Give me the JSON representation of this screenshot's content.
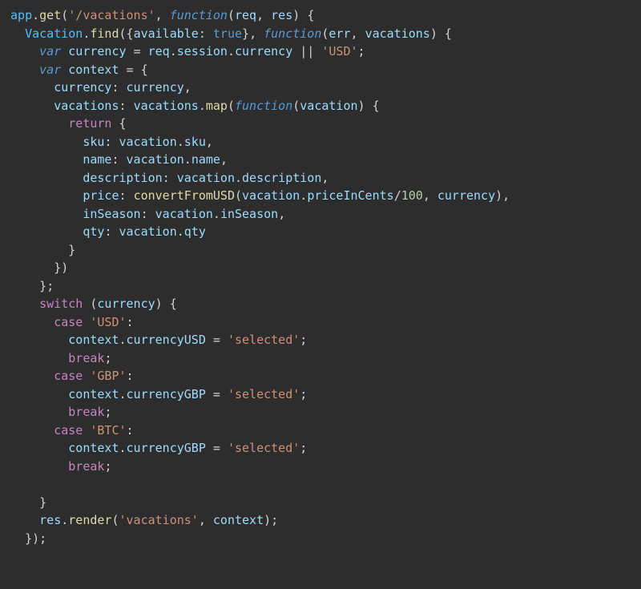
{
  "code": {
    "app": "app",
    "get": "get",
    "route_vacations": "'/vacations'",
    "function": "function",
    "req": "req",
    "res": "res",
    "Vacation": "Vacation",
    "find": "find",
    "available": "available",
    "true": "true",
    "err": "err",
    "vacations": "vacations",
    "var": "var",
    "currency": "currency",
    "session": "session",
    "usd_default": "'USD'",
    "context": "context",
    "currency_prop": "currency",
    "vacations_prop": "vacations",
    "map": "map",
    "vacation": "vacation",
    "return": "return",
    "sku": "sku",
    "name": "name",
    "description": "description",
    "price": "price",
    "convertFromUSD": "convertFromUSD",
    "priceInCents": "priceInCents",
    "hundred": "100",
    "inSeason": "inSeason",
    "qty": "qty",
    "switch": "switch",
    "case": "case",
    "usd_case": "'USD'",
    "gbp_case": "'GBP'",
    "btc_case": "'BTC'",
    "currencyUSD": "currencyUSD",
    "currencyGBP": "currencyGBP",
    "selected": "'selected'",
    "break": "break",
    "render": "render",
    "vacations_str": "'vacations'"
  }
}
